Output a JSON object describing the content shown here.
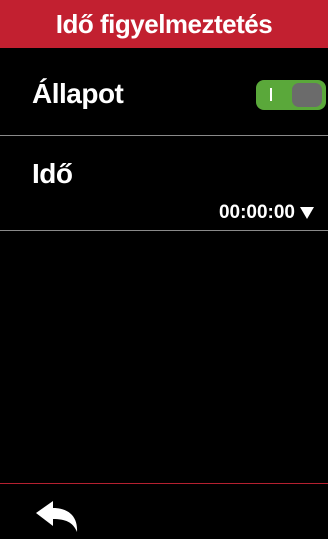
{
  "header": {
    "title": "Idő figyelmeztetés"
  },
  "status_row": {
    "label": "Állapot",
    "toggle_on": true
  },
  "time_row": {
    "label": "Idő",
    "value": "00:00:00"
  },
  "footer": {
    "back_icon": "back-arrow-icon"
  },
  "colors": {
    "header_bg": "#c22030",
    "toggle_on": "#5aa83a",
    "toggle_knob": "#6b6b6b",
    "divider": "#8a8a8a",
    "footer_divider": "#b52030"
  }
}
